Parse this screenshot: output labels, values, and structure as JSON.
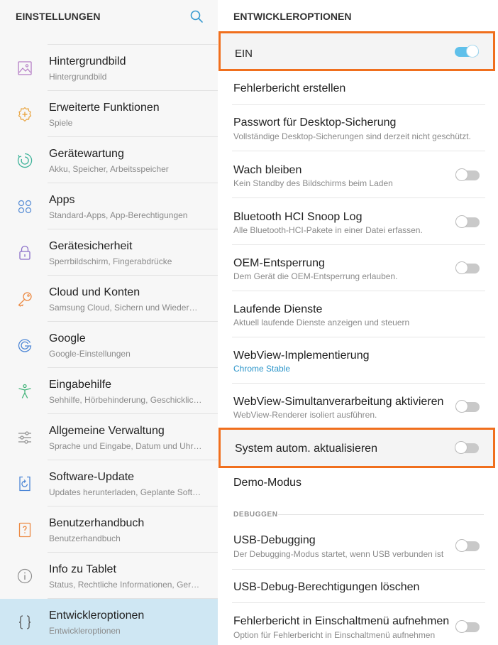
{
  "left": {
    "title": "EINSTELLUNGEN",
    "items": [
      {
        "title": "Hintergrundbild",
        "subtitle": "Hintergrundbild",
        "icon": "image-icon"
      },
      {
        "title": "Erweiterte Funktionen",
        "subtitle": "Spiele",
        "icon": "plus-gear-icon"
      },
      {
        "title": "Gerätewartung",
        "subtitle": "Akku, Speicher, Arbeitsspeicher",
        "icon": "device-care-icon"
      },
      {
        "title": "Apps",
        "subtitle": "Standard-Apps, App-Berechtigungen",
        "icon": "apps-grid-icon"
      },
      {
        "title": "Gerätesicherheit",
        "subtitle": "Sperrbildschirm, Fingerabdrücke",
        "icon": "lock-icon"
      },
      {
        "title": "Cloud und Konten",
        "subtitle": "Samsung Cloud, Sichern und Wiederher…",
        "icon": "key-icon"
      },
      {
        "title": "Google",
        "subtitle": "Google-Einstellungen",
        "icon": "google-icon"
      },
      {
        "title": "Eingabehilfe",
        "subtitle": "Sehhilfe, Hörbehinderung, Geschicklich…",
        "icon": "accessibility-icon"
      },
      {
        "title": "Allgemeine Verwaltung",
        "subtitle": "Sprache und Eingabe, Datum und Uhrze…",
        "icon": "sliders-icon"
      },
      {
        "title": "Software-Update",
        "subtitle": "Updates herunterladen, Geplante Softw…",
        "icon": "software-update-icon"
      },
      {
        "title": "Benutzerhandbuch",
        "subtitle": "Benutzerhandbuch",
        "icon": "manual-icon"
      },
      {
        "title": "Info zu Tablet",
        "subtitle": "Status, Rechtliche Informationen, Gerät…",
        "icon": "info-icon"
      },
      {
        "title": "Entwickleroptionen",
        "subtitle": "Entwickleroptionen",
        "icon": "braces-icon"
      }
    ]
  },
  "right": {
    "title": "ENTWICKLEROPTIONEN",
    "main_toggle": {
      "label": "EIN",
      "on": true
    },
    "items": [
      {
        "title": "Fehlerbericht erstellen"
      },
      {
        "title": "Passwort für Desktop-Sicherung",
        "subtitle": "Vollständige Desktop-Sicherungen sind derzeit nicht geschützt."
      },
      {
        "title": "Wach bleiben",
        "subtitle": "Kein Standby des Bildschirms beim Laden",
        "toggle": false
      },
      {
        "title": "Bluetooth HCI Snoop Log",
        "subtitle": "Alle Bluetooth-HCI-Pakete in einer Datei erfassen.",
        "toggle": false
      },
      {
        "title": "OEM-Entsperrung",
        "subtitle": "Dem Gerät die OEM-Entsperrung erlauben.",
        "toggle": false
      },
      {
        "title": "Laufende Dienste",
        "subtitle": "Aktuell laufende Dienste anzeigen und steuern"
      },
      {
        "title": "WebView-Implementierung",
        "subtitle": "Chrome Stable"
      },
      {
        "title": "WebView-Simultanverarbeitung aktivieren",
        "subtitle": "WebView-Renderer isoliert ausführen.",
        "toggle": false
      },
      {
        "title": "System autom. aktualisieren",
        "toggle": false
      },
      {
        "title": "Demo-Modus"
      }
    ],
    "section_label": "DEBUGGEN",
    "debug_items": [
      {
        "title": "USB-Debugging",
        "subtitle": "Der Debugging-Modus startet, wenn USB verbunden ist",
        "toggle": false
      },
      {
        "title": "USB-Debug-Berechtigungen löschen"
      },
      {
        "title": "Fehlerbericht in Einschaltmenü aufnehmen",
        "subtitle": "Option für Fehlerbericht in Einschaltmenü aufnehmen",
        "toggle": false
      }
    ]
  },
  "colors": {
    "accent": "#2a94c9",
    "highlight": "#f06f1d",
    "selected_bg": "#cfe7f3",
    "toggle_on": "#5fc0ea"
  }
}
